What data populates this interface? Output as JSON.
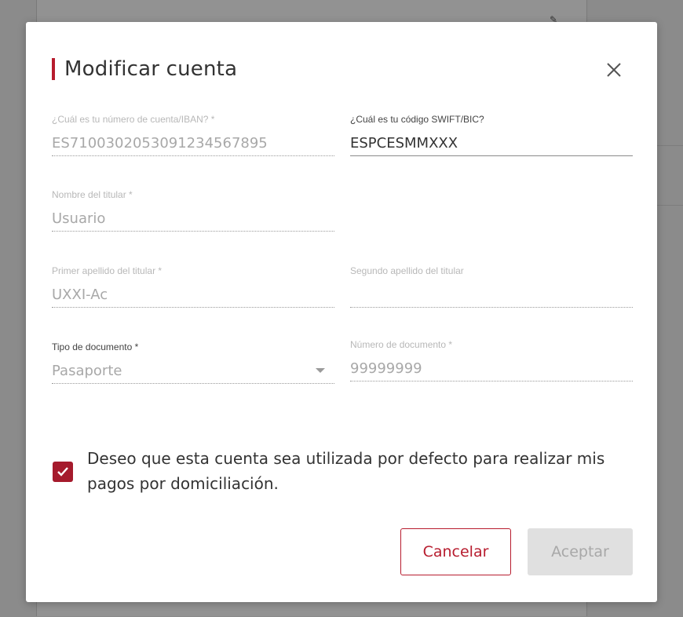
{
  "dialog": {
    "title": "Modificar cuenta",
    "close_icon": "close-icon"
  },
  "fields": {
    "iban": {
      "label": "¿Cuál es tu número de cuenta/IBAN? *",
      "value": "ES7100302053091234567895"
    },
    "swift": {
      "label": "¿Cuál es tu código SWIFT/BIC?",
      "value": "ESPCESMMXXX"
    },
    "holder_name": {
      "label": "Nombre del titular *",
      "value": "Usuario"
    },
    "first_surname": {
      "label": "Primer apellido del titular *",
      "value": "UXXI-Ac"
    },
    "second_surname": {
      "label": "Segundo apellido del titular",
      "value": ""
    },
    "doc_type": {
      "label": "Tipo de documento *",
      "value": "Pasaporte"
    },
    "doc_number": {
      "label": "Número de documento *",
      "value": "99999999"
    }
  },
  "default_checkbox": {
    "checked": true,
    "label": "Deseo que esta cuenta sea utilizada por defecto para realizar mis pagos por domiciliación."
  },
  "buttons": {
    "cancel": "Cancelar",
    "accept": "Aceptar"
  },
  "colors": {
    "accent": "#b71c2e",
    "checkbox": "#a51a2c",
    "disabled_button": "#e0e0e0"
  }
}
